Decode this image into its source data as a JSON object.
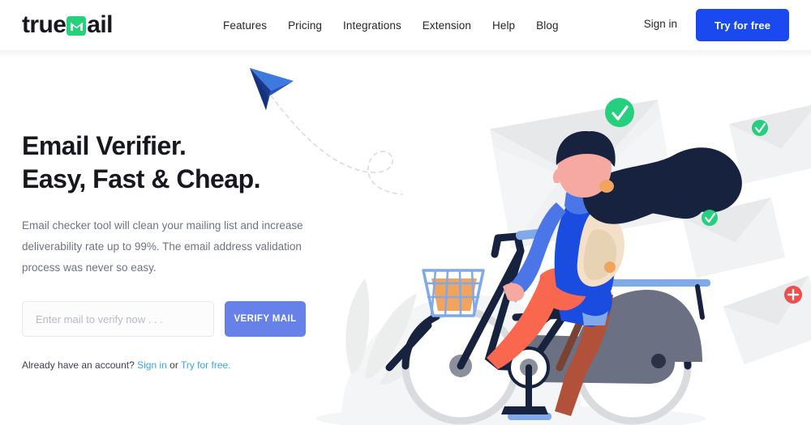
{
  "header": {
    "logo": {
      "pre": "true",
      "mark_icon": "gmail-envelope-m-icon",
      "post": "ail"
    },
    "nav": [
      {
        "label": "Features"
      },
      {
        "label": "Pricing"
      },
      {
        "label": "Integrations"
      },
      {
        "label": "Extension"
      },
      {
        "label": "Help"
      },
      {
        "label": "Blog"
      }
    ],
    "signin_label": "Sign in",
    "cta_label": "Try for free"
  },
  "hero": {
    "title_line1": "Email Verifier.",
    "title_line2": "Easy, Fast & Cheap.",
    "subtitle": "Email checker tool will clean your mailing list and increase deliverability rate up to 99%. The email address validation process was never so easy.",
    "input_placeholder": "Enter mail to verify now . . .",
    "input_value": "",
    "verify_label": "VERIFY MAIL",
    "footer_prefix": "Already have an account? ",
    "footer_signin": "Sign in",
    "footer_mid": " or ",
    "footer_try": "Try for free."
  },
  "illustration": {
    "alt": "woman riding bicycle with envelopes and verification badges",
    "badges": [
      {
        "name": "check-badge-large",
        "symbol": "✓",
        "color": "#25cf7e"
      },
      {
        "name": "check-badge-small-top",
        "symbol": "✓",
        "color": "#25cf7e"
      },
      {
        "name": "check-badge-small-mid",
        "symbol": "✓",
        "color": "#25cf7e"
      },
      {
        "name": "plus-badge",
        "symbol": "+",
        "color": "#ef4e4e"
      }
    ]
  },
  "colors": {
    "brand_blue": "#1a49ef",
    "button_blue": "#6682e8",
    "link_blue": "#36a6e8",
    "green": "#25cf7e",
    "red": "#ef4e4e",
    "navy": "#17223f",
    "coral": "#f9674f",
    "text_dark": "#16181d",
    "text_muted": "#6d7480"
  }
}
